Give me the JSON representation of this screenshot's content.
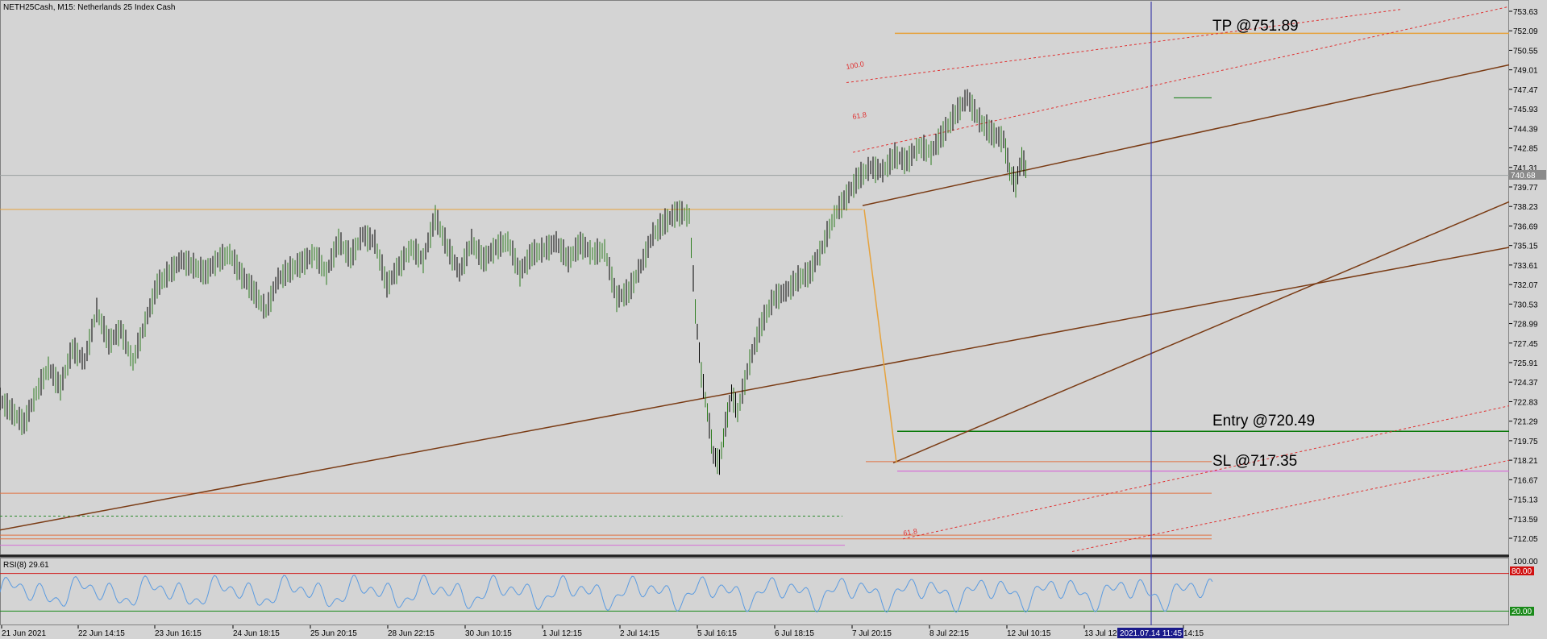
{
  "header": {
    "title": "NETH25Cash, M15:  Netherlands 25 Index Cash"
  },
  "chart_data": {
    "type": "line",
    "title": "NETH25Cash, M15:  Netherlands 25 Index Cash",
    "price_axis": {
      "ticks": [
        "753.63",
        "752.09",
        "750.55",
        "749.01",
        "747.47",
        "745.93",
        "744.39",
        "742.85",
        "741.31",
        "739.77",
        "738.23",
        "736.69",
        "735.15",
        "733.61",
        "732.07",
        "730.53",
        "728.99",
        "727.45",
        "725.91",
        "724.37",
        "722.83",
        "721.29",
        "719.75",
        "718.21",
        "716.67",
        "715.13",
        "713.59",
        "712.05"
      ],
      "ylim": [
        710.9,
        754.3
      ],
      "current_price": "740.68"
    },
    "x_labels": [
      "21 Jun 2021",
      "22 Jun 14:15",
      "23 Jun 16:15",
      "24 Jun 18:15",
      "25 Jun 20:15",
      "28 Jun 22:15",
      "30 Jun 10:15",
      "1 Jul 12:15",
      "2 Jul 14:15",
      "5 Jul 16:15",
      "6 Jul 18:15",
      "7 Jul 20:15",
      "8 Jul 22:15",
      "12 Jul 10:15",
      "13 Jul 12:15",
      "14:15"
    ],
    "crosshair_time": "2021.07.14 11:45",
    "price_series": {
      "name": "NETH25Cash M15 close",
      "points": [
        [
          0.0,
          723.0
        ],
        [
          0.01,
          722.0
        ],
        [
          0.02,
          721.1
        ],
        [
          0.03,
          723.5
        ],
        [
          0.04,
          725.5
        ],
        [
          0.05,
          724.0
        ],
        [
          0.06,
          727.0
        ],
        [
          0.07,
          726.0
        ],
        [
          0.08,
          730.0
        ],
        [
          0.09,
          727.5
        ],
        [
          0.1,
          728.5
        ],
        [
          0.11,
          726.0
        ],
        [
          0.12,
          729.0
        ],
        [
          0.13,
          732.0
        ],
        [
          0.14,
          733.0
        ],
        [
          0.15,
          734.0
        ],
        [
          0.16,
          733.5
        ],
        [
          0.17,
          733.0
        ],
        [
          0.18,
          734.0
        ],
        [
          0.19,
          734.5
        ],
        [
          0.2,
          732.8
        ],
        [
          0.21,
          731.5
        ],
        [
          0.22,
          730.0
        ],
        [
          0.23,
          732.5
        ],
        [
          0.24,
          733.2
        ],
        [
          0.25,
          733.8
        ],
        [
          0.26,
          734.5
        ],
        [
          0.27,
          733.0
        ],
        [
          0.28,
          735.5
        ],
        [
          0.29,
          734.2
        ],
        [
          0.3,
          736.0
        ],
        [
          0.31,
          735.4
        ],
        [
          0.32,
          732.0
        ],
        [
          0.33,
          733.5
        ],
        [
          0.34,
          735.0
        ],
        [
          0.35,
          734.0
        ],
        [
          0.36,
          737.4
        ],
        [
          0.37,
          735.0
        ],
        [
          0.38,
          733.0
        ],
        [
          0.39,
          735.4
        ],
        [
          0.4,
          734.0
        ],
        [
          0.41,
          735.0
        ],
        [
          0.42,
          735.5
        ],
        [
          0.43,
          733.0
        ],
        [
          0.44,
          734.5
        ],
        [
          0.45,
          734.8
        ],
        [
          0.46,
          735.4
        ],
        [
          0.47,
          734.0
        ],
        [
          0.48,
          735.3
        ],
        [
          0.49,
          734.5
        ],
        [
          0.5,
          734.8
        ],
        [
          0.51,
          731.0
        ],
        [
          0.52,
          731.5
        ],
        [
          0.53,
          733.5
        ],
        [
          0.54,
          736.0
        ],
        [
          0.55,
          737.0
        ],
        [
          0.56,
          737.8
        ],
        [
          0.57,
          737.5
        ],
        [
          0.575,
          730.0
        ],
        [
          0.58,
          725.0
        ],
        [
          0.585,
          722.0
        ],
        [
          0.59,
          718.6
        ],
        [
          0.595,
          718.0
        ],
        [
          0.6,
          721.0
        ],
        [
          0.605,
          723.5
        ],
        [
          0.61,
          722.0
        ],
        [
          0.62,
          726.0
        ],
        [
          0.63,
          729.0
        ],
        [
          0.64,
          731.0
        ],
        [
          0.65,
          731.5
        ],
        [
          0.66,
          732.5
        ],
        [
          0.67,
          733.0
        ],
        [
          0.68,
          735.0
        ],
        [
          0.69,
          737.5
        ],
        [
          0.7,
          739.0
        ],
        [
          0.71,
          740.5
        ],
        [
          0.72,
          741.3
        ],
        [
          0.73,
          741.0
        ],
        [
          0.74,
          742.2
        ],
        [
          0.75,
          741.8
        ],
        [
          0.76,
          743.0
        ],
        [
          0.77,
          742.5
        ],
        [
          0.78,
          744.0
        ],
        [
          0.79,
          745.5
        ],
        [
          0.8,
          746.8
        ],
        [
          0.81,
          745.0
        ],
        [
          0.82,
          744.0
        ],
        [
          0.83,
          743.5
        ],
        [
          0.835,
          741.0
        ],
        [
          0.84,
          740.0
        ],
        [
          0.845,
          742.0
        ],
        [
          0.85,
          740.8
        ]
      ]
    },
    "rsi": {
      "label": "RSI(8) 29.61",
      "ticks": [
        "100.00",
        "80.00",
        "20.00"
      ],
      "overbought_label": "80.00",
      "oversold_label": "20.00"
    },
    "annotations": {
      "tp": {
        "label": "TP @751.89",
        "price": 751.89
      },
      "entry": {
        "label": "Entry @720.49",
        "price": 720.49
      },
      "sl": {
        "label": "SL @717.35",
        "price": 717.35
      },
      "fib_labels": [
        "100.0",
        "61.8",
        "61.8"
      ]
    },
    "colors": {
      "background": "#d4d4d4",
      "bull_candle": "#2e7d1f",
      "bear_candle": "#000000",
      "channel": "#7a3b14",
      "tp_line": "#e6a23c",
      "entry_line": "#0a7a0a",
      "sl_line": "#d66fd6",
      "fib_red": "#e03030",
      "rsi_line": "#5b9be0",
      "crosshair": "#2020a0"
    }
  }
}
